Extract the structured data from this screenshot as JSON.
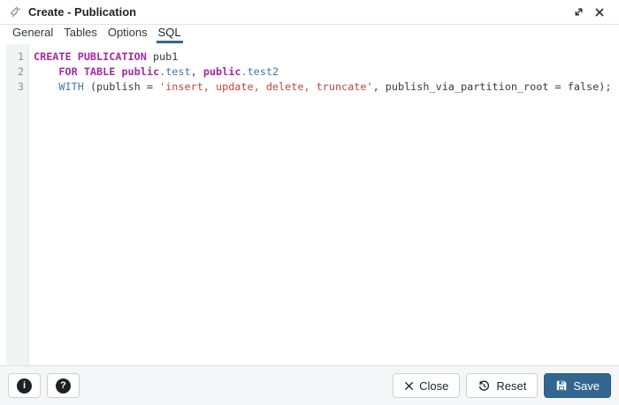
{
  "window": {
    "title": "Create - Publication",
    "icon": "publication-broadcast-icon"
  },
  "tabs": [
    {
      "label": "General",
      "active": false
    },
    {
      "label": "Tables",
      "active": false
    },
    {
      "label": "Options",
      "active": false
    },
    {
      "label": "SQL",
      "active": true
    }
  ],
  "editor": {
    "lines": [
      {
        "number": "1",
        "segments": [
          [
            "keyword",
            "CREATE PUBLICATION"
          ],
          [
            "plain",
            " pub1"
          ]
        ]
      },
      {
        "number": "2",
        "segments": [
          [
            "plain",
            "    "
          ],
          [
            "keyword",
            "FOR TABLE"
          ],
          [
            "plain",
            " "
          ],
          [
            "keyword",
            "public"
          ],
          [
            "punct",
            "."
          ],
          [
            "name",
            "test"
          ],
          [
            "plain",
            ", "
          ],
          [
            "keyword",
            "public"
          ],
          [
            "punct",
            "."
          ],
          [
            "name",
            "test2"
          ]
        ]
      },
      {
        "number": "3",
        "segments": [
          [
            "plain",
            "    "
          ],
          [
            "name",
            "WITH"
          ],
          [
            "plain",
            " (publish = "
          ],
          [
            "string",
            "'insert, update, delete, truncate'"
          ],
          [
            "plain",
            ", publish_via_partition_root = false);"
          ]
        ]
      }
    ]
  },
  "footer": {
    "info_glyph": "i",
    "help_glyph": "?",
    "close_label": "Close",
    "reset_label": "Reset",
    "save_label": "Save"
  },
  "colors": {
    "accent": "#326690",
    "keyword": "#a626a4",
    "identifier": "#4678a0",
    "string": "#c5443c",
    "text": "#383a42"
  }
}
